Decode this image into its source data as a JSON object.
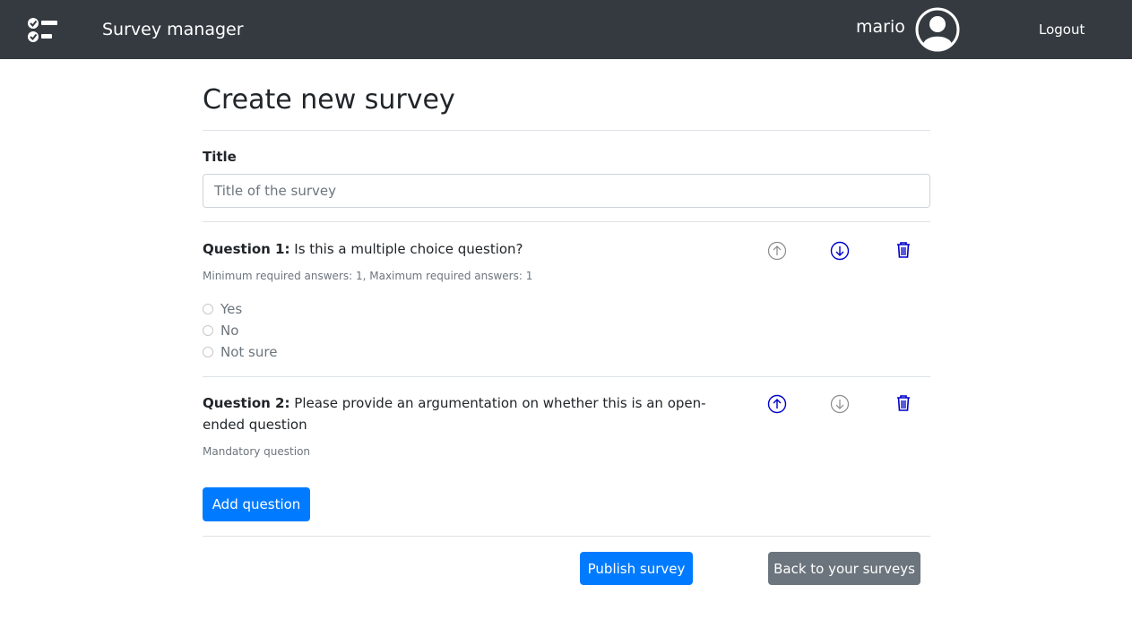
{
  "navbar": {
    "brand": "Survey manager",
    "username": "mario",
    "logout_label": "Logout",
    "logo_icon": "checklist-icon",
    "avatar_icon": "user-circle-icon"
  },
  "page": {
    "title": "Create new survey"
  },
  "survey_form": {
    "title_label": "Title",
    "title_placeholder": "Title of the survey",
    "title_value": ""
  },
  "questions": [
    {
      "number_label": "Question 1:",
      "text": "Is this a multiple choice question?",
      "meta": "Minimum required answers: 1, Maximum required answers: 1",
      "options": [
        "Yes",
        "No",
        "Not sure"
      ],
      "move_up_enabled": false,
      "move_down_enabled": true
    },
    {
      "number_label": "Question 2:",
      "text": "Please provide an argumentation on whether this is an open-ended question",
      "meta": "Mandatory question",
      "options": [],
      "move_up_enabled": true,
      "move_down_enabled": false
    }
  ],
  "actions": {
    "add_question_label": "Add question",
    "publish_label": "Publish survey",
    "back_label": "Back to your surveys"
  },
  "colors": {
    "navbar_bg": "#343a40",
    "primary": "#007bff",
    "secondary": "#6c757d",
    "icon_active": "#0000cc",
    "icon_disabled": "#8a8a8a"
  }
}
